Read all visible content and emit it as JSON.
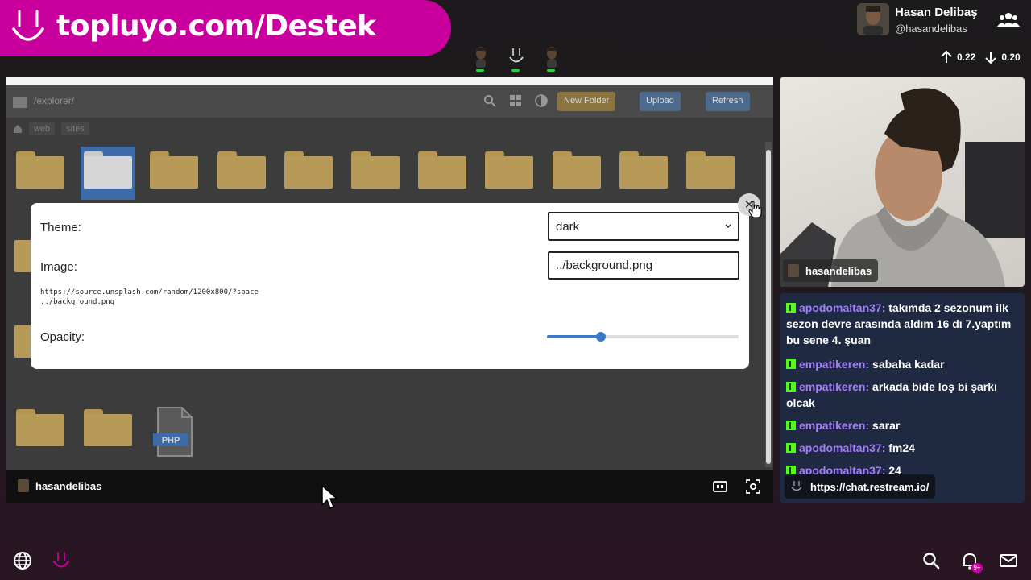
{
  "brand": {
    "banner_text": "topluyo.com/Destek",
    "accent_color": "#c9009e"
  },
  "user": {
    "name": "Hasan Delibaş",
    "handle": "@hasandelibas"
  },
  "net_stats": {
    "upload": "0.22",
    "download": "0.20"
  },
  "screen": {
    "file_manager": {
      "path": "/explorer/",
      "breadcrumb": [
        "web",
        "sites"
      ],
      "buttons": [
        "New Folder",
        "Upload",
        "Refresh"
      ]
    },
    "modal": {
      "theme_label": "Theme:",
      "theme_value": "dark",
      "image_label": "Image:",
      "image_value": "../background.png",
      "hint_line_1": "https://source.unsplash.com/random/1200x800/?space",
      "hint_line_2": "../background.png",
      "opacity_label": "Opacity:",
      "opacity_value": 0.28,
      "close_symbol": "✕"
    },
    "php_file_label": "PHP",
    "sharer_name": "hasandelibas"
  },
  "webcam": {
    "name": "hasandelibas"
  },
  "chat": {
    "messages": [
      {
        "author": "apodomaltan37:",
        "text": "takımda 2 sezonum ilk sezon devre arasında aldım 16 dı 7.yaptım bu sene 4. şuan"
      },
      {
        "author": "empatikeren:",
        "text": "sabaha kadar"
      },
      {
        "author": "empatikeren:",
        "text": "arkada bide loş bi şarkı olcak"
      },
      {
        "author": "empatikeren:",
        "text": "sarar"
      },
      {
        "author": "apodomaltan37:",
        "text": "fm24"
      },
      {
        "author": "apodomaltan37:",
        "text": "24"
      }
    ],
    "link": "https://chat.restream.io/"
  },
  "notifications": {
    "badge": "9+"
  },
  "icons": {
    "globe": "globe-icon",
    "logo": "topluyo-logo-icon",
    "search": "search-icon",
    "bell": "bell-icon",
    "mail": "mail-icon",
    "group": "group-icon",
    "upload": "arrow-up-icon",
    "download": "arrow-down-icon"
  }
}
